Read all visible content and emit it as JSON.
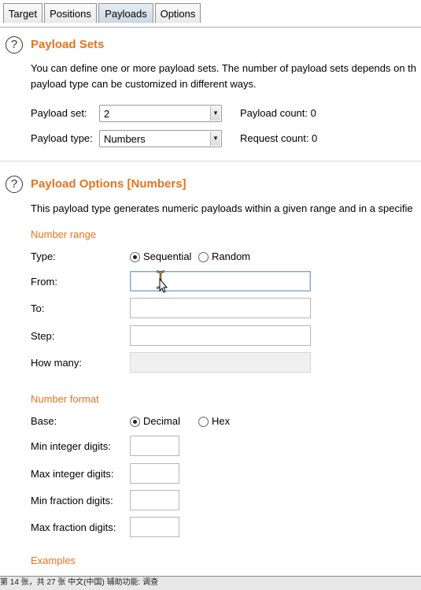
{
  "tabs": [
    {
      "label": "Target"
    },
    {
      "label": "Positions"
    },
    {
      "label": "Payloads"
    },
    {
      "label": "Options"
    }
  ],
  "active_tab": "Payloads",
  "payload_sets": {
    "title": "Payload Sets",
    "desc_line1": "You can define one or more payload sets. The number of payload sets depends on th",
    "desc_line2": "payload type can be customized in different ways.",
    "set_label": "Payload set:",
    "set_value": "2",
    "type_label": "Payload type:",
    "type_value": "Numbers",
    "payload_count": "Payload count: 0",
    "request_count": "Request count: 0"
  },
  "payload_options": {
    "title": "Payload Options [Numbers]",
    "desc": "This payload type generates numeric payloads within a given range and in a specifie",
    "number_range": {
      "heading": "Number range",
      "type_label": "Type:",
      "sequential": "Sequential",
      "random": "Random",
      "type_selected": "Sequential",
      "from_label": "From:",
      "from_value": "",
      "to_label": "To:",
      "to_value": "",
      "step_label": "Step:",
      "step_value": "",
      "how_many_label": "How many:",
      "how_many_value": ""
    },
    "number_format": {
      "heading": "Number format",
      "base_label": "Base:",
      "decimal": "Decimal",
      "hex": "Hex",
      "base_selected": "Decimal",
      "min_int_label": "Min integer digits:",
      "max_int_label": "Max integer digits:",
      "min_frac_label": "Min fraction digits:",
      "max_frac_label": "Max fraction digits:"
    },
    "examples_heading": "Examples"
  },
  "statusbar": {
    "text": "第 14 张，共 27 张    中文(中国)    辅助功能: 调查"
  },
  "colors": {
    "accent": "#e8731f",
    "tab_active": "#cdd8e4"
  }
}
